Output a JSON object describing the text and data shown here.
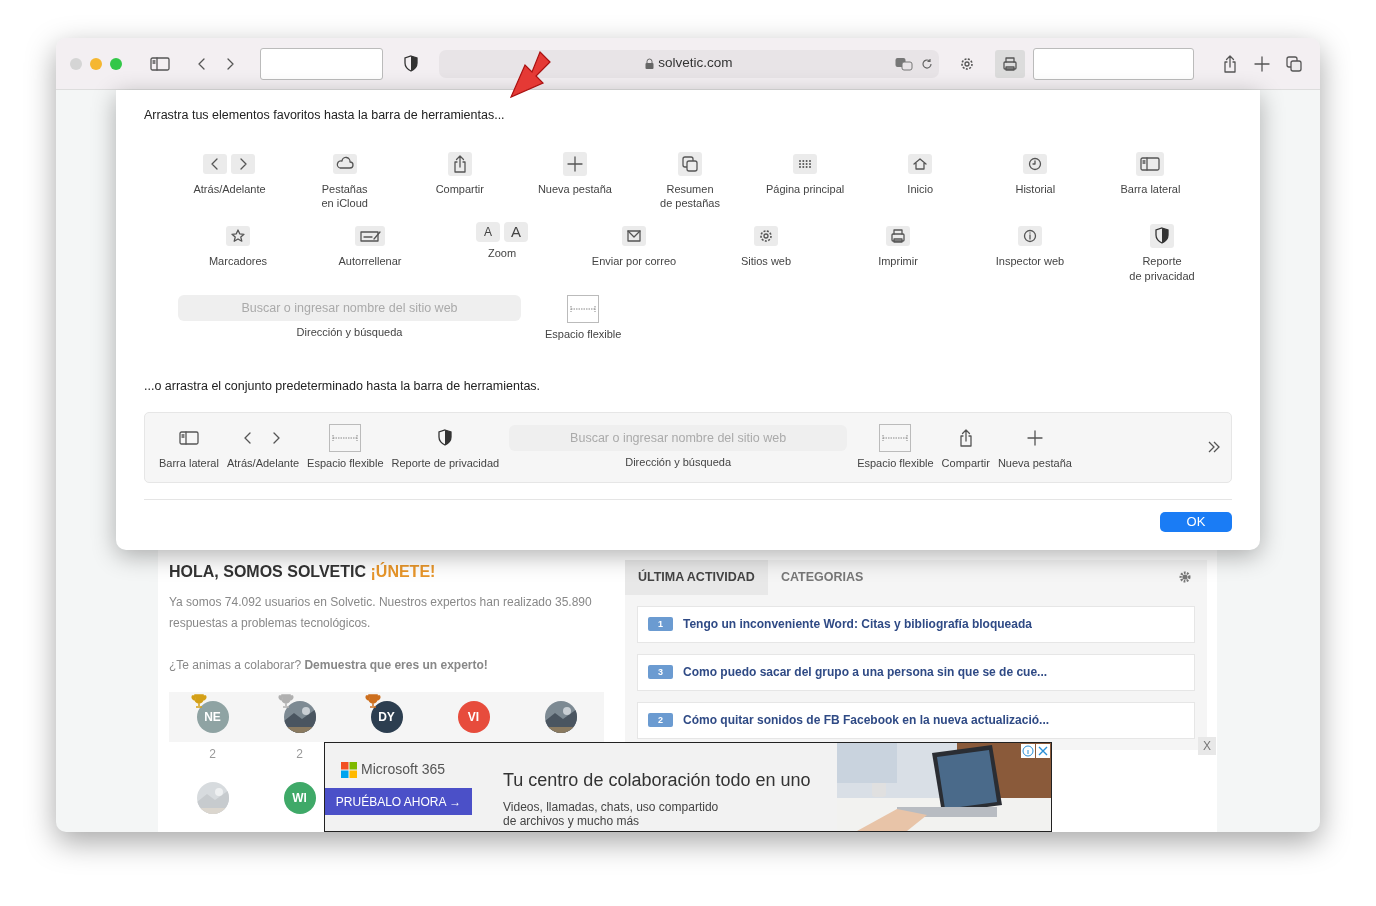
{
  "browser": {
    "address": "solvetic.com"
  },
  "customize": {
    "heading": "Arrastra tus elementos favoritos hasta la barra de herramientas...",
    "rows": [
      {
        "items": [
          {
            "kind": "back-forward",
            "label": "Atrás/Adelante"
          },
          {
            "kind": "cloud",
            "label": "Pestañas\nen iCloud"
          },
          {
            "kind": "share",
            "label": "Compartir"
          },
          {
            "kind": "plus",
            "label": "Nueva pestaña"
          },
          {
            "kind": "tabs",
            "label": "Resumen\nde pestañas"
          },
          {
            "kind": "grid",
            "label": "Página principal"
          },
          {
            "kind": "home",
            "label": "Inicio"
          },
          {
            "kind": "clock",
            "label": "Historial"
          },
          {
            "kind": "sidebar",
            "label": "Barra lateral"
          }
        ]
      },
      {
        "items": [
          {
            "kind": "star",
            "label": "Marcadores"
          },
          {
            "kind": "autofill",
            "label": "Autorrellenar"
          },
          {
            "kind": "zoom",
            "glyphs": [
              "A",
              "A"
            ],
            "label": "Zoom"
          },
          {
            "kind": "mail",
            "label": "Enviar por correo"
          },
          {
            "kind": "gear",
            "label": "Sitios web"
          },
          {
            "kind": "print",
            "label": "Imprimir"
          },
          {
            "kind": "info",
            "label": "Inspector web"
          },
          {
            "kind": "shield",
            "label": "Reporte\nde privacidad"
          }
        ]
      },
      {
        "items": [
          {
            "kind": "address",
            "placeholder": "Buscar o ingresar nombre del sitio web",
            "label": "Dirección y búsqueda"
          },
          {
            "kind": "flexible",
            "label": "Espacio flexible"
          }
        ]
      }
    ],
    "default_heading": "...o arrastra el conjunto predeterminado hasta la barra de herramientas.",
    "default_set": [
      {
        "kind": "sidebar",
        "label": "Barra lateral"
      },
      {
        "kind": "back-forward",
        "label": "Atrás/Adelante"
      },
      {
        "kind": "flexible",
        "label": "Espacio flexible"
      },
      {
        "kind": "shield",
        "label": "Reporte de privacidad"
      },
      {
        "kind": "address",
        "placeholder": "Buscar o ingresar nombre del sitio web",
        "label": "Dirección y búsqueda"
      },
      {
        "kind": "flexible",
        "label": "Espacio flexible"
      },
      {
        "kind": "share",
        "label": "Compartir"
      },
      {
        "kind": "plus",
        "label": "Nueva pestaña"
      }
    ],
    "ok": "OK"
  },
  "page": {
    "welcome": {
      "title": "HOLA, SOMOS SOLVETIC",
      "highlight": "¡ÚNETE!",
      "text": "Ya somos 74.092 usuarios en Solvetic. Nuestros expertos han realizado 35.890 respuestas a problemas tecnológicos.",
      "invite": "¿Te animas a colaborar? **Demuestra que eres un experto!**"
    },
    "avatars": [
      {
        "kind": "initials",
        "initials": "NE",
        "color": "#8fa3a3",
        "trophy": {
          "color": "#d4a017"
        }
      },
      {
        "kind": "picture",
        "trophy": {
          "color": "#b0b0b0"
        }
      },
      {
        "kind": "initials",
        "initials": "DY",
        "color": "#2c3e50",
        "trophy": {
          "color": "#cd6f1e"
        }
      },
      {
        "kind": "initials",
        "initials": "VI",
        "color": "#e74c3c"
      },
      {
        "kind": "picture"
      }
    ],
    "counts": [
      "2",
      "2"
    ],
    "avatars_faded": [
      {
        "kind": "picture"
      },
      {
        "kind": "initials",
        "initials": "WI",
        "color": "#3fa968"
      }
    ],
    "tabs": [
      {
        "label": "ÚLTIMA ACTIVIDAD",
        "selected": true
      },
      {
        "label": "CATEGORIAS",
        "selected": false
      }
    ],
    "activity": [
      {
        "count": "1",
        "title": "Tengo un inconveniente Word: Citas y bibliografía bloqueada"
      },
      {
        "count": "3",
        "title": "Como puedo sacar del grupo a una persona sin que se de cue..."
      },
      {
        "count": "2",
        "title": "Cómo quitar sonidos de FB Facebook en la nueva actualizació..."
      }
    ]
  },
  "ad": {
    "brand": "Microsoft 365",
    "cta": "PRUÉBALO AHORA →",
    "headline": "Tu centro de colaboración todo en uno",
    "text": "Videos, llamadas, chats, uso compartido\nde archivos y mucho más",
    "close": "X"
  }
}
